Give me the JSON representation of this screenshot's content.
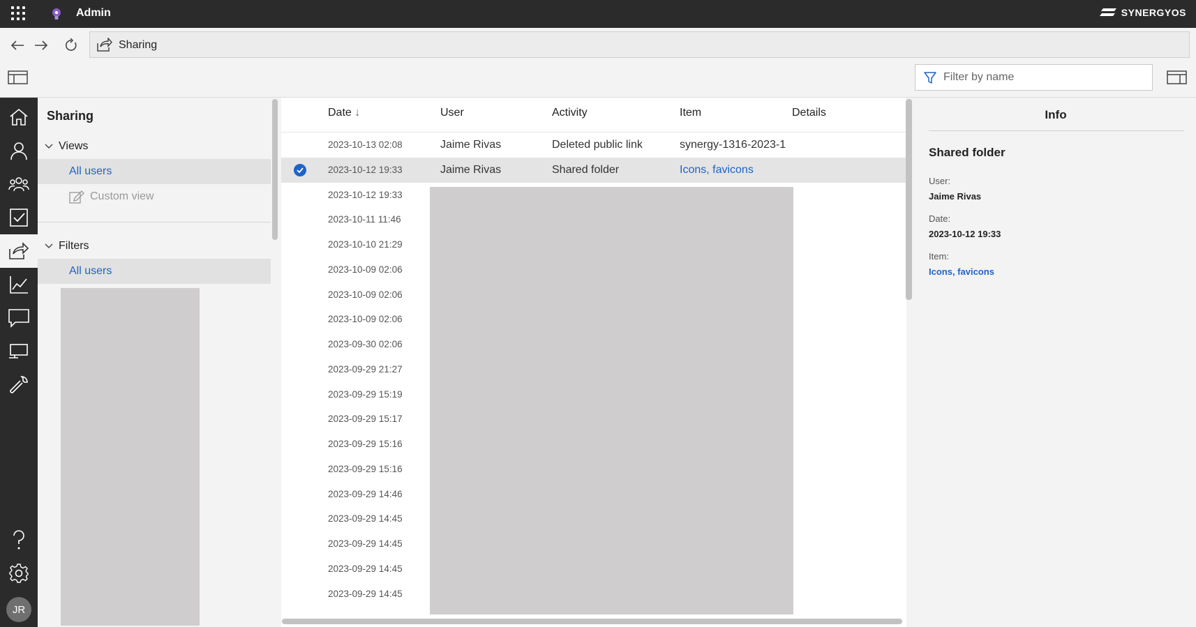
{
  "app": {
    "title": "Admin",
    "brand": "SYNERGYOS"
  },
  "address": {
    "path": "Sharing"
  },
  "toolbar": {
    "filter_placeholder": "Filter by name"
  },
  "user_avatar": {
    "initials": "JR"
  },
  "nav": {
    "title": "Sharing",
    "views_label": "Views",
    "views": [
      {
        "label": "All users"
      },
      {
        "label": "Custom view"
      }
    ],
    "filters_label": "Filters",
    "filters": [
      {
        "label": "All users"
      }
    ]
  },
  "table": {
    "columns": {
      "date": "Date",
      "user": "User",
      "activity": "Activity",
      "item": "Item",
      "details": "Details"
    },
    "sort_indicator": "↓",
    "rows": [
      {
        "date": "2023-10-13 02:08",
        "user": "Jaime Rivas",
        "activity": "Deleted public link",
        "item": "synergy-1316-2023-1",
        "link": false
      },
      {
        "date": "2023-10-12 19:33",
        "user": "Jaime Rivas",
        "activity": "Shared folder",
        "item": "Icons, favicons",
        "link": true
      },
      {
        "date": "2023-10-12 19:33"
      },
      {
        "date": "2023-10-11 11:46"
      },
      {
        "date": "2023-10-10 21:29"
      },
      {
        "date": "2023-10-09 02:06"
      },
      {
        "date": "2023-10-09 02:06"
      },
      {
        "date": "2023-10-09 02:06"
      },
      {
        "date": "2023-09-30 02:06"
      },
      {
        "date": "2023-09-29 21:27"
      },
      {
        "date": "2023-09-29 15:19"
      },
      {
        "date": "2023-09-29 15:17"
      },
      {
        "date": "2023-09-29 15:16"
      },
      {
        "date": "2023-09-29 15:16"
      },
      {
        "date": "2023-09-29 14:46"
      },
      {
        "date": "2023-09-29 14:45"
      },
      {
        "date": "2023-09-29 14:45"
      },
      {
        "date": "2023-09-29 14:45"
      },
      {
        "date": "2023-09-29 14:45"
      }
    ]
  },
  "info": {
    "title": "Info",
    "heading": "Shared folder",
    "user_label": "User:",
    "user_value": "Jaime Rivas",
    "date_label": "Date:",
    "date_value": "2023-10-12 19:33",
    "item_label": "Item:",
    "item_value": "Icons, favicons"
  },
  "colors": {
    "accent": "#1e63c8",
    "topbar": "#2b2b2b",
    "redacted": "#cfcdce"
  }
}
